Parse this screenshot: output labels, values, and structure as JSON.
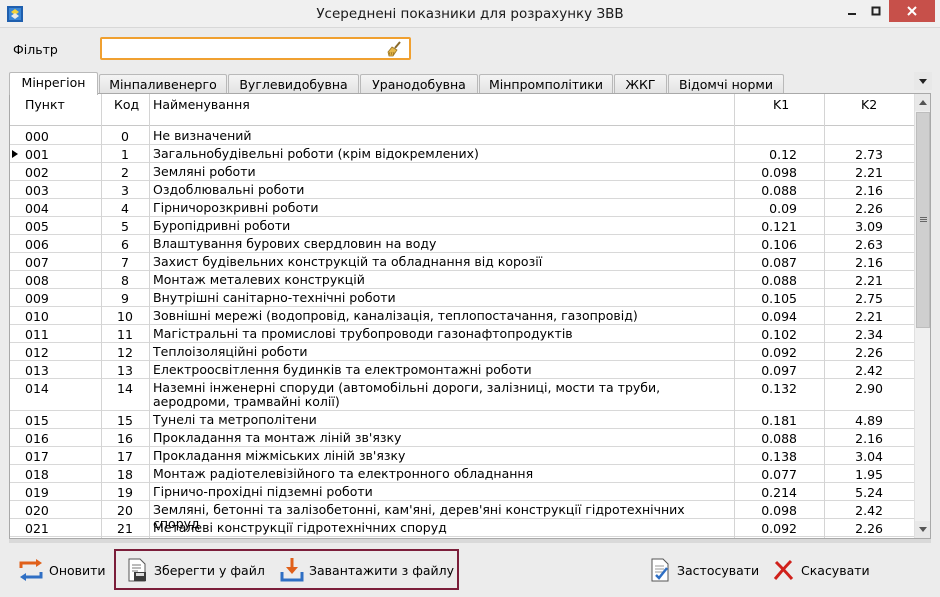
{
  "window": {
    "title": "Усереднені показники для розрахунку ЗВВ"
  },
  "filter": {
    "label": "Фільтр",
    "value": ""
  },
  "tabs": [
    {
      "label": "Мінрегіон",
      "active": true
    },
    {
      "label": "Мінпаливенерго"
    },
    {
      "label": "Вуглевидобувна"
    },
    {
      "label": "Уранодобувна"
    },
    {
      "label": "Мінпромполітики"
    },
    {
      "label": "ЖКГ"
    },
    {
      "label": "Відомчі норми"
    }
  ],
  "grid": {
    "columns": {
      "item": "Пункт",
      "code": "Код",
      "name": "Найменування",
      "k1": "K1",
      "k2": "K2"
    },
    "rows": [
      {
        "item": "000",
        "code": "0",
        "name": "Не визначений",
        "k1": "",
        "k2": ""
      },
      {
        "item": "001",
        "code": "1",
        "name": "Загальнобудівельні роботи (крім відокремлених)",
        "k1": "0.12",
        "k2": "2.73",
        "current": true
      },
      {
        "item": "002",
        "code": "2",
        "name": "Земляні роботи",
        "k1": "0.098",
        "k2": "2.21"
      },
      {
        "item": "003",
        "code": "3",
        "name": "Оздоблювальні роботи",
        "k1": "0.088",
        "k2": "2.16"
      },
      {
        "item": "004",
        "code": "4",
        "name": "Гірничорозкривні роботи",
        "k1": "0.09",
        "k2": "2.26"
      },
      {
        "item": "005",
        "code": "5",
        "name": "Буропідривні роботи",
        "k1": "0.121",
        "k2": "3.09"
      },
      {
        "item": "006",
        "code": "6",
        "name": "Влаштування бурових свердловин на воду",
        "k1": "0.106",
        "k2": "2.63"
      },
      {
        "item": "007",
        "code": "7",
        "name": "Захист будівельних конструкцій та обладнання від корозії",
        "k1": "0.087",
        "k2": "2.16"
      },
      {
        "item": "008",
        "code": "8",
        "name": "Монтаж металевих конструкцій",
        "k1": "0.088",
        "k2": "2.21"
      },
      {
        "item": "009",
        "code": "9",
        "name": "Внутрішні санітарно-технічні роботи",
        "k1": "0.105",
        "k2": "2.75"
      },
      {
        "item": "010",
        "code": "10",
        "name": "Зовнішні мережі (водопровід, каналізація, теплопостачання, газопровід)",
        "k1": "0.094",
        "k2": "2.21"
      },
      {
        "item": "011",
        "code": "11",
        "name": "Магістральні та промислові трубопроводи газонафтопродуктів",
        "k1": "0.102",
        "k2": "2.34"
      },
      {
        "item": "012",
        "code": "12",
        "name": "Теплоізоляційні роботи",
        "k1": "0.092",
        "k2": "2.26"
      },
      {
        "item": "013",
        "code": "13",
        "name": "Електроосвітлення будинків та електромонтажні роботи",
        "k1": "0.097",
        "k2": "2.42"
      },
      {
        "item": "014",
        "code": "14",
        "name": "Наземні інженерні споруди (автомобільні дороги, залізниці, мости та труби, аеродроми, трамвайні колії)",
        "k1": "0.132",
        "k2": "2.90",
        "tall": true
      },
      {
        "item": "015",
        "code": "15",
        "name": "Тунелі та метрополітени",
        "k1": "0.181",
        "k2": "4.89"
      },
      {
        "item": "016",
        "code": "16",
        "name": "Прокладання та монтаж ліній зв'язку",
        "k1": "0.088",
        "k2": "2.16"
      },
      {
        "item": "017",
        "code": "17",
        "name": "Прокладання міжміських ліній зв'язку",
        "k1": "0.138",
        "k2": "3.04"
      },
      {
        "item": "018",
        "code": "18",
        "name": "Монтаж радіотелевізійного та електронного обладнання",
        "k1": "0.077",
        "k2": "1.95"
      },
      {
        "item": "019",
        "code": "19",
        "name": "Гірничо-прохідні підземні роботи",
        "k1": "0.214",
        "k2": "5.24"
      },
      {
        "item": "020",
        "code": "20",
        "name": "Земляні, бетонні та залізобетонні, кам'яні, дерев'яні конструкції гідротехнічних споруд",
        "k1": "0.098",
        "k2": "2.42"
      },
      {
        "item": "021",
        "code": "21",
        "name": "Металеві конструкції гідротехнічних споруд",
        "k1": "0.092",
        "k2": "2.26"
      }
    ]
  },
  "buttons": {
    "refresh": "Оновити",
    "save_file": "Зберегти у файл",
    "load_file": "Завантажити з файлу",
    "apply": "Застосувати",
    "cancel": "Скасувати"
  }
}
